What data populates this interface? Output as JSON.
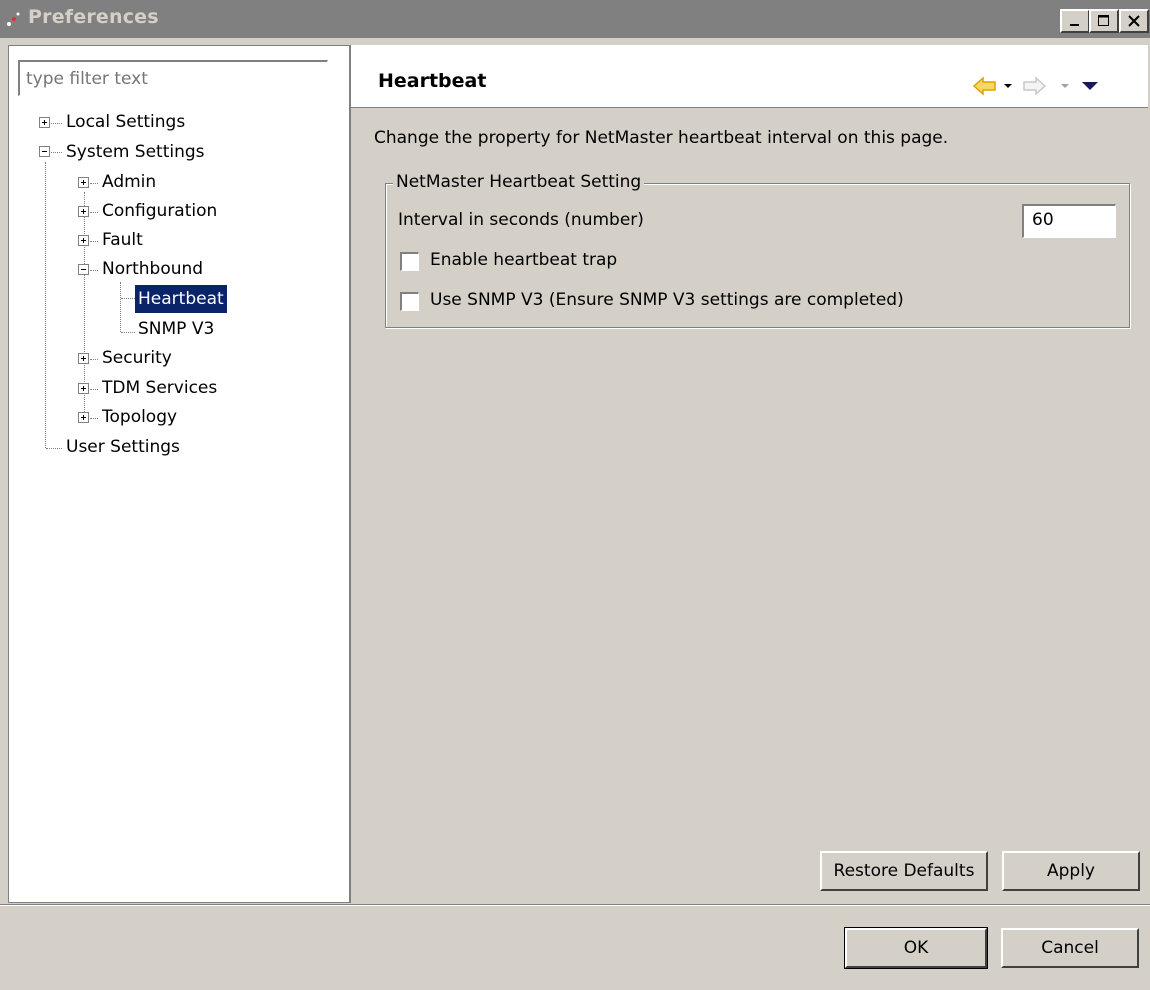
{
  "window": {
    "title": "Preferences"
  },
  "filter": {
    "placeholder": "type filter text"
  },
  "tree": {
    "local_settings": "Local Settings",
    "system_settings": "System Settings",
    "admin": "Admin",
    "configuration": "Configuration",
    "fault": "Fault",
    "northbound": "Northbound",
    "heartbeat": "Heartbeat",
    "snmp_v3": "SNMP V3",
    "security": "Security",
    "tdm_services": "TDM Services",
    "topology": "Topology",
    "user_settings": "User Settings",
    "selected": "Heartbeat"
  },
  "page": {
    "title": "Heartbeat",
    "description": "Change the property for NetMaster heartbeat interval on this page.",
    "group_title": "NetMaster Heartbeat Setting",
    "interval_label": "Interval in seconds (number)",
    "interval_value": "60",
    "enable_trap_label": "Enable heartbeat trap",
    "enable_trap_checked": false,
    "snmp_v3_label": "Use SNMP V3 (Ensure SNMP V3 settings are completed)",
    "snmp_v3_checked": false,
    "restore_defaults": "Restore Defaults",
    "apply": "Apply"
  },
  "dialog": {
    "ok": "OK",
    "cancel": "Cancel"
  },
  "icons": {
    "back": "back-arrow-icon",
    "back_dropdown": "chevron-down-icon",
    "forward": "forward-arrow-icon",
    "forward_dropdown": "chevron-down-icon",
    "view_menu": "view-menu-icon",
    "minimize": "minimize-icon",
    "maximize": "maximize-icon",
    "close": "close-icon"
  },
  "colors": {
    "selection": "#0a246a",
    "back_arrow": "#f0b400",
    "titlebar": "#808080"
  }
}
